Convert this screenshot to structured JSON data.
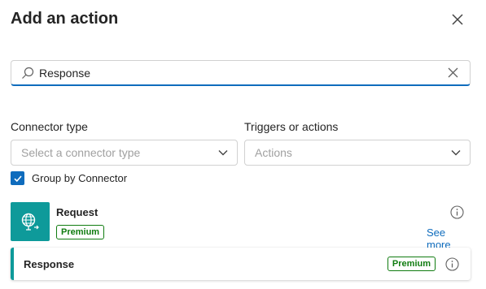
{
  "header": {
    "title": "Add an action"
  },
  "search": {
    "value": "Response"
  },
  "filters": {
    "connector_type": {
      "label": "Connector type",
      "placeholder": "Select a connector type"
    },
    "triggers_actions": {
      "label": "Triggers or actions",
      "placeholder": "Actions"
    }
  },
  "group_by": {
    "label": "Group by Connector",
    "checked": true
  },
  "connector": {
    "name": "Request",
    "badge": "Premium",
    "see_more": "See more",
    "icon": "globe-request-icon"
  },
  "actions": [
    {
      "name": "Response",
      "badge": "Premium"
    }
  ],
  "colors": {
    "accent": "#0f6cbd",
    "connector": "#0e9a9a",
    "premium": "#107c10"
  }
}
